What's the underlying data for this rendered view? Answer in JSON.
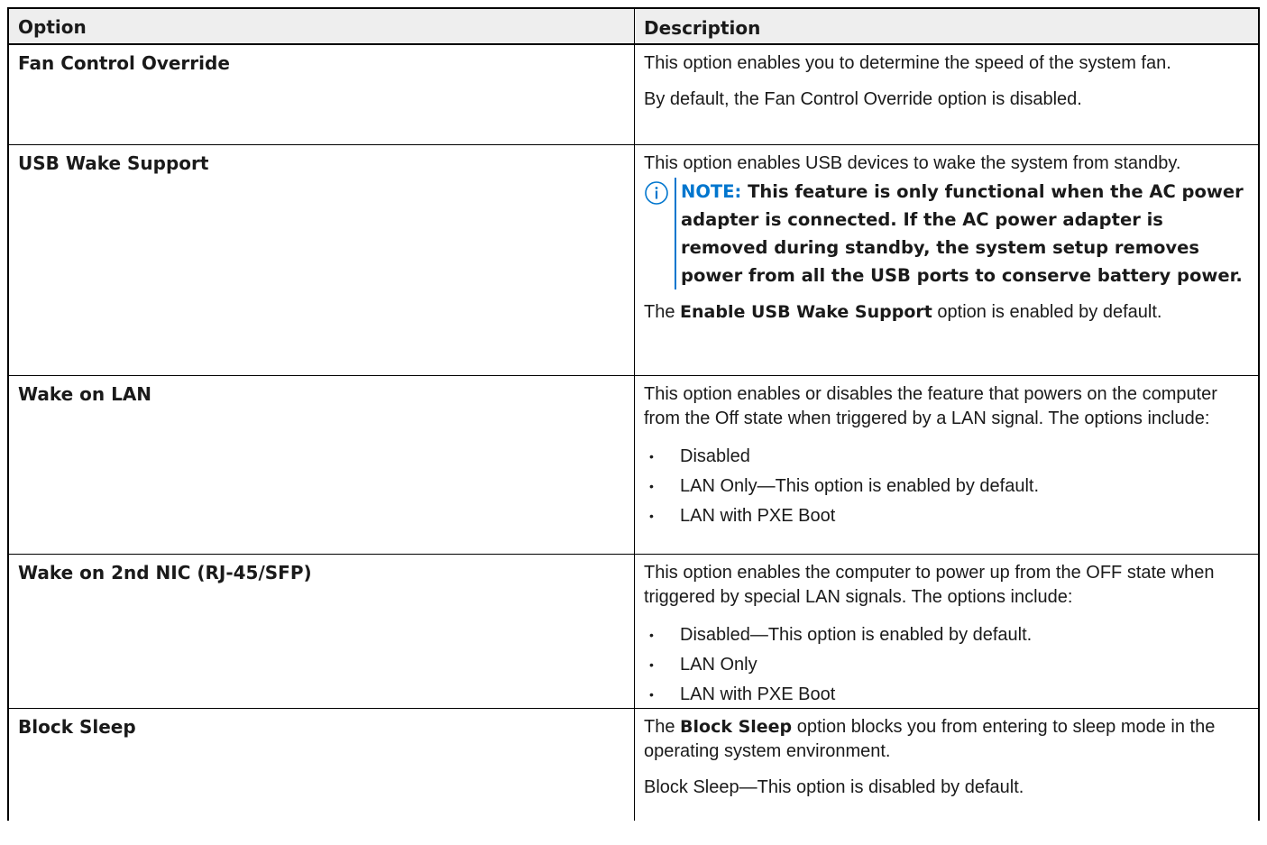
{
  "header": {
    "option": "Option",
    "description": "Description"
  },
  "rows": [
    {
      "option": "Fan Control Override",
      "p1": "This option enables you to determine the speed of the system fan.",
      "p2": "By default, the Fan Control Override option is disabled."
    },
    {
      "option": "USB Wake Support",
      "p1": "This option enables USB devices to wake the system from standby.",
      "note_label": "NOTE:",
      "note_text": "This feature is only functional when the AC power adapter is connected. If the AC power adapter is removed during standby, the system setup removes power from all the USB ports to conserve battery power.",
      "p2_pre": "The",
      "p2_bold": "Enable USB Wake Support",
      "p2_post": "option is enabled by default."
    },
    {
      "option": "Wake on LAN",
      "p1": "This option enables or disables the feature that powers on the computer from the Off state when triggered by a LAN signal. The options include:",
      "bullets": [
        "Disabled",
        "LAN Only—This option is enabled by default.",
        "LAN with PXE Boot"
      ]
    },
    {
      "option": "Wake on 2nd NIC (RJ-45/SFP)",
      "p1": "This option enables the computer to power up from the OFF state when triggered by special LAN signals. The options include:",
      "bullets": [
        "Disabled—This option is enabled by default.",
        "LAN Only",
        "LAN with PXE Boot"
      ]
    },
    {
      "option": "Block Sleep",
      "p1_pre": "The",
      "p1_bold": "Block Sleep",
      "p1_post": "option blocks you from entering to sleep mode in the operating system environment.",
      "p2": "Block Sleep—This option is disabled by default."
    }
  ],
  "bullet_char": "•",
  "colors": {
    "header_bg": "#eeeeee",
    "note_accent": "#0076ce",
    "border": "#000000"
  },
  "icons": {
    "note": "info-circle-icon"
  }
}
